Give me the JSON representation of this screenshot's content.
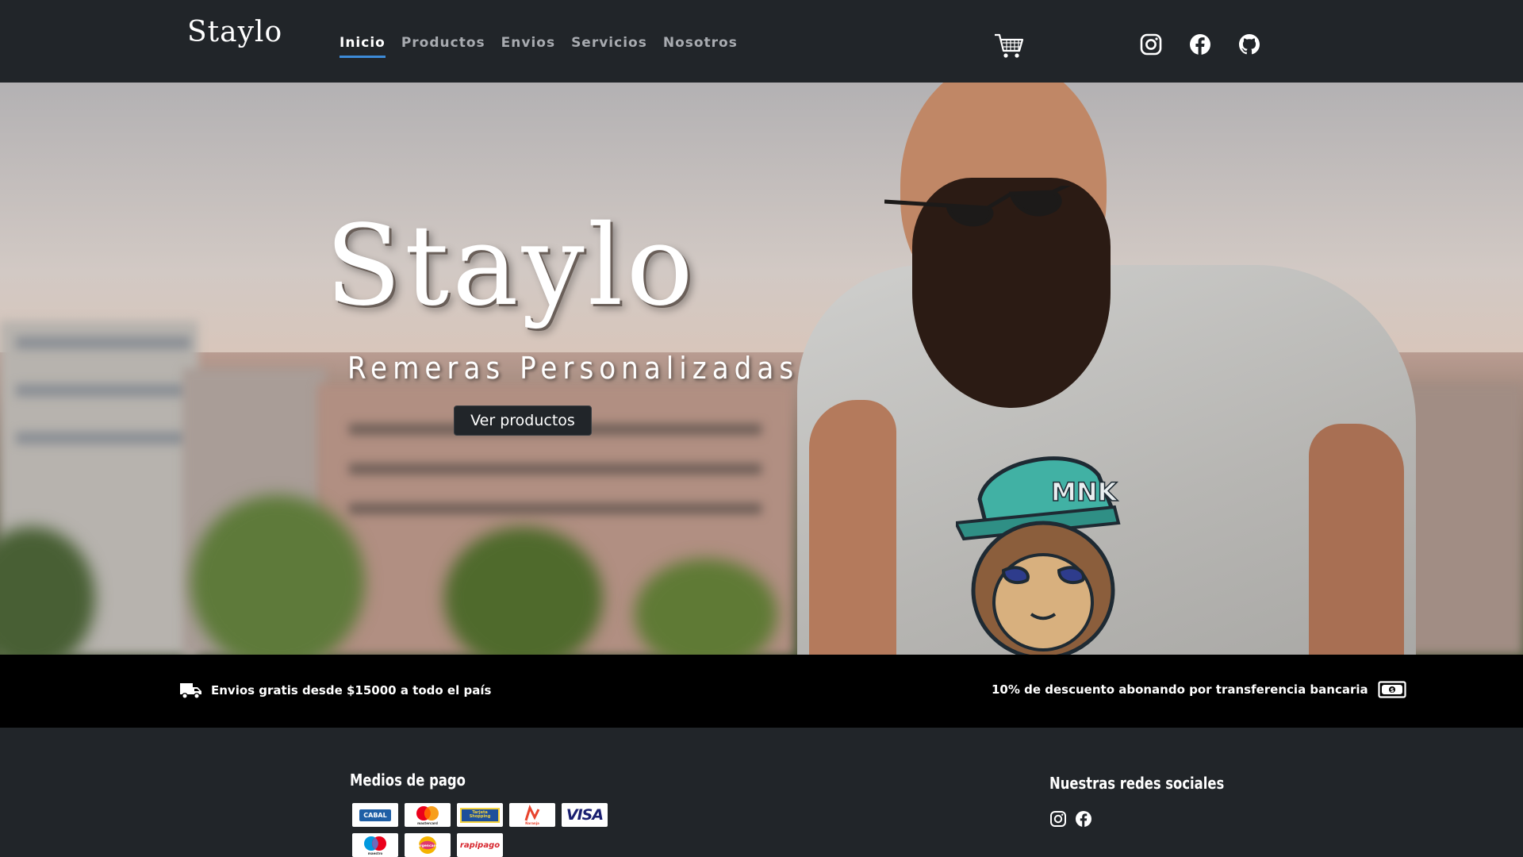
{
  "brand": {
    "logo_text": "Staylo"
  },
  "nav": {
    "items": [
      {
        "label": "Inicio",
        "active": true
      },
      {
        "label": "Productos",
        "active": false
      },
      {
        "label": "Envios",
        "active": false
      },
      {
        "label": "Servicios",
        "active": false
      },
      {
        "label": "Nosotros",
        "active": false
      }
    ],
    "icons": [
      "cart-icon",
      "instagram-icon",
      "facebook-icon",
      "github-icon"
    ]
  },
  "hero": {
    "title": "Staylo",
    "subtitle": "Remeras Personalizadas",
    "button_label": "Ver productos",
    "shirt_print_text": "MNK"
  },
  "promo": {
    "left_text": "Envios gratis desde $15000 a todo el país",
    "right_text": "10% de descuento abonando por transferencia bancaria"
  },
  "footer": {
    "payment_title": "Medios de pago",
    "payment_methods": [
      {
        "name": "CABAL"
      },
      {
        "name": "mastercard"
      },
      {
        "name": "Tarjeta Shopping"
      },
      {
        "name": "Naranja"
      },
      {
        "name": "VISA"
      },
      {
        "name": "maestro"
      },
      {
        "name": "Argencard"
      },
      {
        "name": "rapipago"
      }
    ],
    "social_title": "Nuestras redes sociales",
    "social_icons": [
      "instagram-icon",
      "facebook-icon"
    ]
  },
  "colors": {
    "navbar_bg": "#212529",
    "accent_underline": "#3d8bd8",
    "promo_bg": "#000000",
    "nav_text": "#a8abb0"
  }
}
